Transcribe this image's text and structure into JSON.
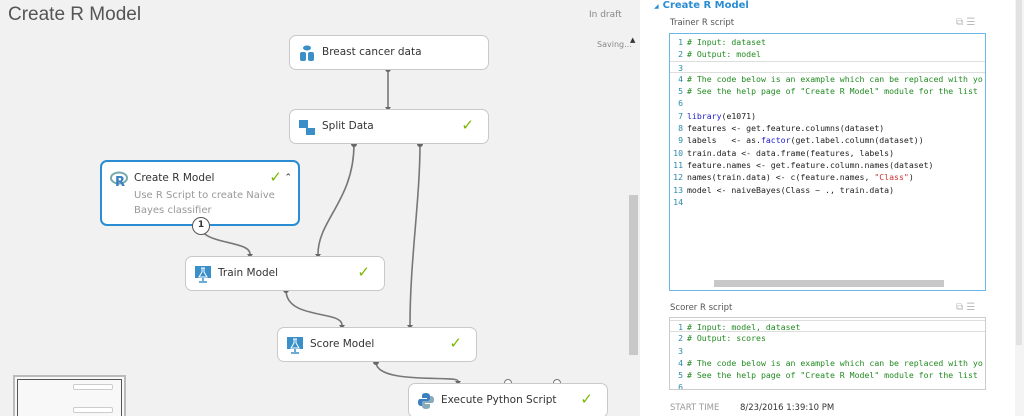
{
  "experiment": {
    "title": "Create R Model",
    "status": "In draft",
    "saving": "Saving..."
  },
  "nodes": {
    "breast": {
      "label": "Breast cancer data",
      "icon": "dataset-icon"
    },
    "split": {
      "label": "Split Data",
      "icon": "split-data-icon",
      "status": "✓"
    },
    "creater": {
      "label": "Create R Model",
      "description": "Use R Script to create Naive Bayes classifier",
      "icon": "r-icon",
      "status": "✓",
      "port": "1"
    },
    "train": {
      "label": "Train Model",
      "icon": "train-model-icon",
      "status": "✓"
    },
    "score": {
      "label": "Score Model",
      "icon": "score-model-icon",
      "status": "✓"
    },
    "python": {
      "label": "Execute Python Script",
      "icon": "python-icon",
      "status": "✓"
    }
  },
  "panel": {
    "title": "Create R Model",
    "trainer": {
      "label": "Trainer R script",
      "lines": [
        [
          [
            "cm",
            "# Input: dataset"
          ]
        ],
        [
          [
            "cm",
            "# Output: model"
          ]
        ],
        [],
        [
          [
            "cm",
            "# The code below is an example which can be replaced with yo"
          ]
        ],
        [
          [
            "cm",
            "# See the help page of \"Create R Model\" module for the list"
          ]
        ],
        [],
        [
          [
            "kw",
            "library"
          ],
          [
            "tx",
            "(e1071)"
          ]
        ],
        [
          [
            "tx",
            "features <- get.feature.columns(dataset)"
          ]
        ],
        [
          [
            "tx",
            "labels   <- as."
          ],
          [
            "kw",
            "factor"
          ],
          [
            "tx",
            "(get.label.column(dataset))"
          ]
        ],
        [
          [
            "tx",
            "train.data <- data.frame(features, labels)"
          ]
        ],
        [
          [
            "tx",
            "feature.names <- get.feature.column.names(dataset)"
          ]
        ],
        [
          [
            "tx",
            "names(train.data) <- c(feature.names, "
          ],
          [
            "st",
            "\"Class\""
          ],
          [
            "tx",
            ")"
          ]
        ],
        [
          [
            "tx",
            "model <- naiveBayes(Class ~ ., train.data)"
          ]
        ],
        []
      ]
    },
    "scorer": {
      "label": "Scorer R script",
      "lines": [
        [
          [
            "cm",
            "# Input: model, dataset"
          ]
        ],
        [
          [
            "cm",
            "# Output: scores"
          ]
        ],
        [],
        [
          [
            "cm",
            "# The code below is an example which can be replaced with yo"
          ]
        ],
        [
          [
            "cm",
            "# See the help page of \"Create R Model\" module for the list"
          ]
        ],
        []
      ]
    },
    "start_time_label": "START TIME",
    "start_time_value": "8/23/2016 1:39:10 PM"
  },
  "colors": {
    "accent": "#2a8dd4",
    "success": "#7ab800",
    "comment": "#228b22"
  }
}
